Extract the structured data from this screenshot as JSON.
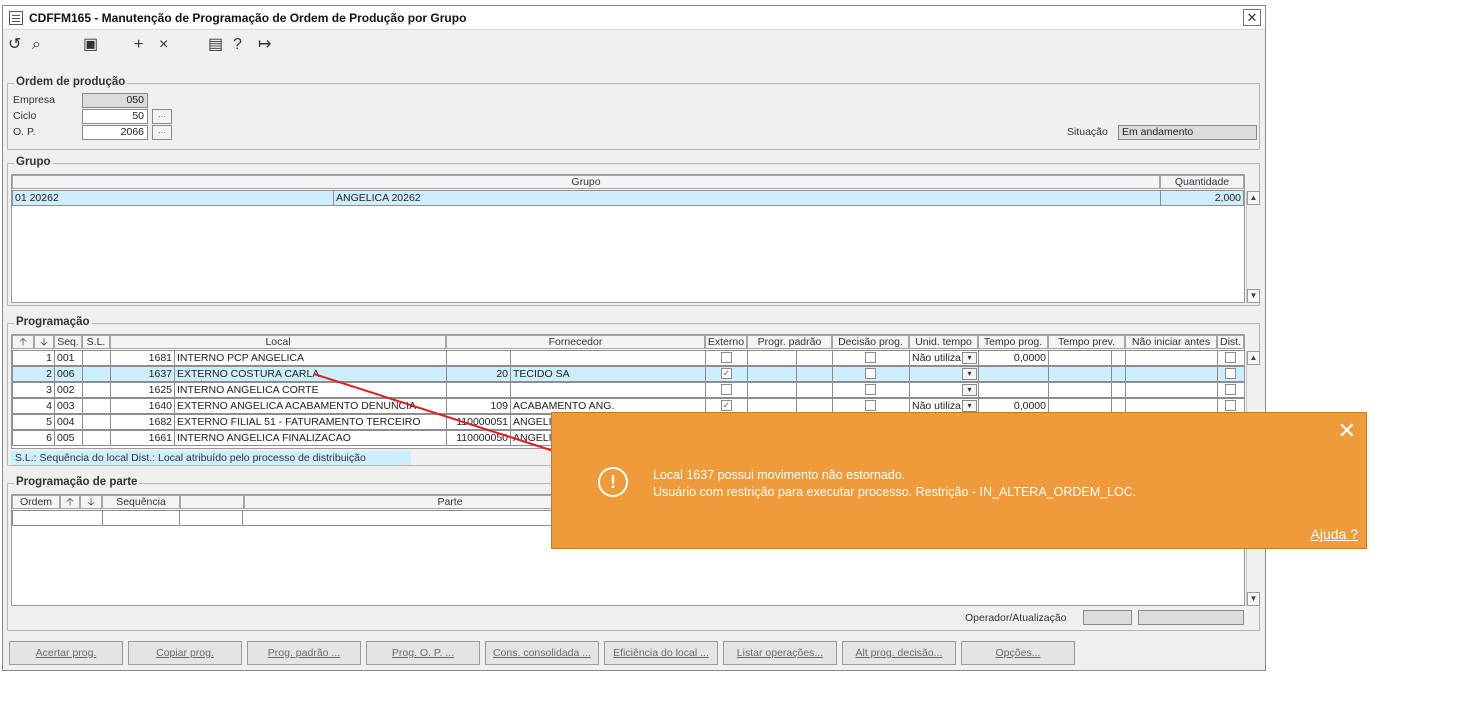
{
  "window": {
    "title": "CDFFM165 - Manutenção de Programação de Ordem de Produção por Grupo"
  },
  "toolbar": {
    "icons": [
      "undo-icon",
      "search-icon",
      "save-icon",
      "add-icon",
      "delete-icon",
      "calendar-icon",
      "help-icon",
      "exit-icon"
    ]
  },
  "ordem": {
    "title": "Ordem de produção",
    "empresa_label": "Empresa",
    "empresa_value": "050",
    "ciclo_label": "Ciclo",
    "ciclo_value": "50",
    "op_label": "O. P.",
    "op_value": "2066",
    "situacao_label": "Situação",
    "situacao_value": "Em andamento"
  },
  "grupo": {
    "title": "Grupo",
    "col_grupo": "Grupo",
    "col_quantidade": "Quantidade",
    "row": {
      "codigo": "01 20262",
      "descricao": "ANGELICA 20262",
      "quantidade": "2,000"
    }
  },
  "programacao": {
    "title": "Programação",
    "headers": {
      "seq": "Seq.",
      "sl": "S.L.",
      "local": "Local",
      "fornecedor": "Fornecedor",
      "externo": "Externo",
      "progr_padrao": "Progr. padrão",
      "decisao": "Decisão prog.",
      "unid_tempo": "Unid. tempo",
      "tempo_prog": "Tempo prog.",
      "tempo_prev": "Tempo prev.",
      "nao_iniciar": "Não iniciar antes",
      "dist": "Dist."
    },
    "rows": [
      {
        "n": "1",
        "seq": "001",
        "cod": "1681",
        "local": "INTERNO PCP ANGELICA",
        "fcod": "",
        "forn": "",
        "externo": false,
        "unid": "Não utiliza",
        "tempo": "0,0000"
      },
      {
        "n": "2",
        "seq": "006",
        "cod": "1637",
        "local": "EXTERNO COSTURA CARLA",
        "fcod": "20",
        "forn": "TECIDO SA",
        "externo": true,
        "unid": "",
        "tempo": ""
      },
      {
        "n": "3",
        "seq": "002",
        "cod": "1625",
        "local": "INTERNO ANGELICA CORTE",
        "fcod": "",
        "forn": "",
        "externo": false,
        "unid": "",
        "tempo": ""
      },
      {
        "n": "4",
        "seq": "003",
        "cod": "1640",
        "local": "EXTERNO ANGELICA ACABAMENTO DENUNCIA",
        "fcod": "109",
        "forn": "ACABAMENTO ANG.",
        "externo": true,
        "unid": "Não utiliza",
        "tempo": "0,0000"
      },
      {
        "n": "5",
        "seq": "004",
        "cod": "1682",
        "local": "EXTERNO FILIAL 51 - FATURAMENTO TERCEIRO",
        "fcod": "110000051",
        "forn": "ANGELIC",
        "externo": false,
        "unid": "",
        "tempo": ""
      },
      {
        "n": "6",
        "seq": "005",
        "cod": "1661",
        "local": "INTERNO ANGELICA FINALIZACAO",
        "fcod": "110000050",
        "forn": "ANGELIC",
        "externo": false,
        "unid": "",
        "tempo": ""
      }
    ],
    "legend": "S.L.: Sequência do local      Dist.: Local atribuído pelo processo de distribuição"
  },
  "parte": {
    "title": "Programação de parte",
    "col_ordem": "Ordem",
    "col_sequencia": "Sequência",
    "col_parte": "Parte"
  },
  "operador_label": "Operador/Atualização",
  "buttons": [
    "Acertar prog.",
    "Copiar prog.",
    "Prog. padrão ...",
    "Prog. O. P. ...",
    "Cons. consolidada ...",
    "Eficiência do local ...",
    "Listar operações...",
    "Alt prog. decisão...",
    "Opções..."
  ],
  "popup": {
    "line1": "Local 1637 possui movimento não estornado.",
    "line2": "Usuário com restrição para executar processo. Restrição - IN_ALTERA_ORDEM_LOC.",
    "help": "Ajuda ?",
    "accent": "#f09b3b"
  }
}
